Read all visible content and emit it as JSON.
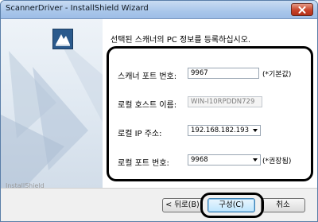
{
  "window": {
    "title": "ScannerDriver - InstallShield Wizard",
    "close_icon": "close-icon"
  },
  "header": {
    "headline": "선택된 스캐너의 PC 정보를 등록하십시오."
  },
  "form": {
    "scanner_port": {
      "label": "스캐너 포트 번호:",
      "value": "9967",
      "hint": "(*기본값)"
    },
    "hostname": {
      "label": "로컬 호스트 이름:",
      "value": "WIN-I10RPDDN729"
    },
    "ip": {
      "label": "로컬 IP 주소:",
      "value": "192.168.182.193"
    },
    "local_port": {
      "label": "로컬 포트 번호:",
      "value": "9968",
      "hint": "(*권장됨)"
    }
  },
  "footer": {
    "brand": "InstallShield",
    "back_label": "< 뒤로(B)",
    "configure_label": "구성(C)",
    "cancel_label": "취소"
  },
  "colors": {
    "accent": "#3c7fb1",
    "close_button": "#c8432a",
    "title_bar": "#a9c6ea"
  }
}
